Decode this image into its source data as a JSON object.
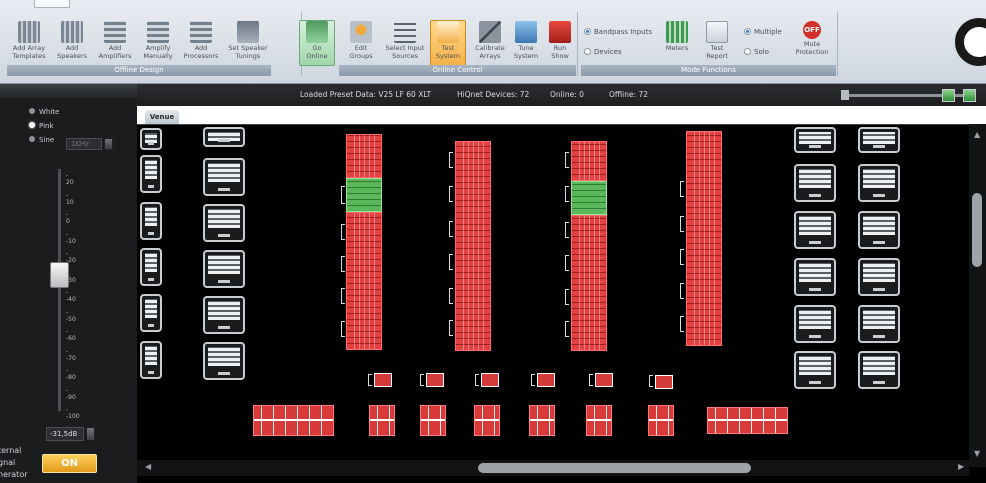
{
  "ribbon": {
    "groups": [
      {
        "label": "Offline Design",
        "buttons": [
          {
            "label": "Add Array\nTemplates",
            "icon": "array-templates-icon"
          },
          {
            "label": "Add\nSpeakers",
            "icon": "speakers-icon"
          },
          {
            "label": "Add\nAmplifiers",
            "icon": "amplifiers-icon"
          },
          {
            "label": "Amplify\nManually",
            "icon": "amplify-icon"
          },
          {
            "label": "Add\nProcessors",
            "icon": "processors-icon"
          },
          {
            "label": "Set Speaker\nTunings",
            "icon": "speaker-tunings-icon"
          },
          {
            "label": "Go\nOnline",
            "icon": "go-online-icon"
          }
        ]
      },
      {
        "label": "Online Control",
        "buttons": [
          {
            "label": "Edit\nGroups",
            "icon": "edit-groups-icon"
          },
          {
            "label": "Select Input\nSources",
            "icon": "input-sources-icon"
          },
          {
            "label": "Test\nSystem",
            "icon": "test-system-icon"
          },
          {
            "label": "Calibrate\nArrays",
            "icon": "calibrate-icon"
          },
          {
            "label": "Tune\nSystem",
            "icon": "tune-icon"
          },
          {
            "label": "Run\nShow",
            "icon": "run-show-icon"
          }
        ]
      },
      {
        "label": "Mode Functions",
        "buttons": [
          {
            "label": "Meters",
            "icon": "meters-icon"
          },
          {
            "label": "Test\nReport",
            "icon": "report-icon"
          },
          {
            "label": "Mute\nProtection",
            "icon": "mute-icon"
          }
        ]
      }
    ],
    "radios": {
      "bandpass": "Bandpass Inputs",
      "devices": "Devices",
      "multiple": "Multiple",
      "solo": "Solo"
    },
    "off_label": "OFF"
  },
  "generator": {
    "options": [
      "White",
      "Pink",
      "Sine"
    ],
    "selected": "Pink",
    "frequency": "1KHz",
    "scale": [
      "- 20",
      "- 10",
      "- 0",
      "- -10",
      "- -20",
      "- -30",
      "- -40",
      "- -50",
      "- -60",
      "- -70",
      "- -80",
      "- -90",
      "- -100"
    ],
    "level_db": "-31,5dB",
    "on_label": "ON",
    "side_label": [
      "ternal",
      "gnal",
      "nerator"
    ]
  },
  "status": {
    "preset": "Loaded Preset Data: V25 LF 60 XLT",
    "hiqnet": "HiQnet Devices: 72",
    "online": "Online: 0",
    "offline": "Offline: 72"
  },
  "venue_tab": "Venue"
}
